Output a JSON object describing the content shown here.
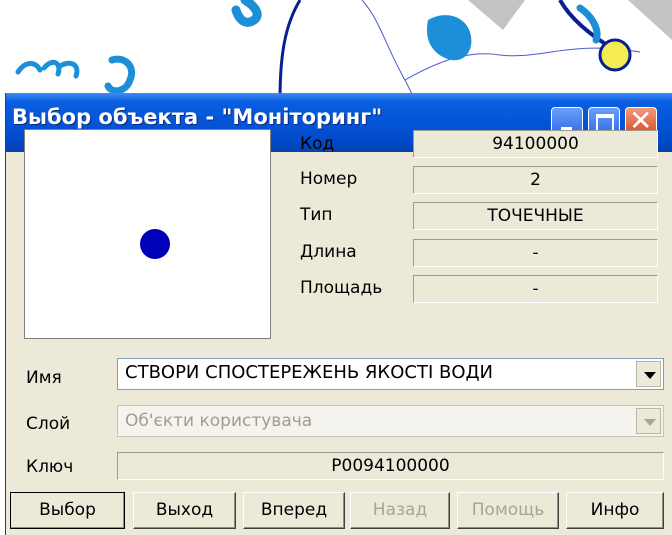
{
  "window": {
    "title": "Выбор объекта - \"Моніторинг\"",
    "controls": [
      "minimize",
      "maximize",
      "close"
    ]
  },
  "preview": {
    "object_shape": "point",
    "object_color": "#0000b8"
  },
  "properties": [
    {
      "label": "Код",
      "value": "94100000"
    },
    {
      "label": "Номер",
      "value": "2"
    },
    {
      "label": "Тип",
      "value": "ТОЧЕЧНЫЕ"
    },
    {
      "label": "Длина",
      "value": "-"
    },
    {
      "label": "Площадь",
      "value": "-"
    }
  ],
  "name_field": {
    "label": "Имя",
    "value": "СТВОРИ СПОСТЕРЕЖЕНЬ ЯКОСТІ ВОДИ"
  },
  "layer_field": {
    "label": "Слой",
    "value": "Об'єкти користувача",
    "enabled": false
  },
  "key_field": {
    "label": "Ключ",
    "value": "P0094100000"
  },
  "buttons": {
    "select": "Выбор",
    "exit": "Выход",
    "forward": "Вперед",
    "back": "Назад",
    "help": "Помощь",
    "info": "Инфо"
  },
  "colors": {
    "titlebar": "#0554d8",
    "dialog_bg": "#ece9d8",
    "map_water": "#1d8fd8",
    "map_road": "#0a1f8f"
  }
}
